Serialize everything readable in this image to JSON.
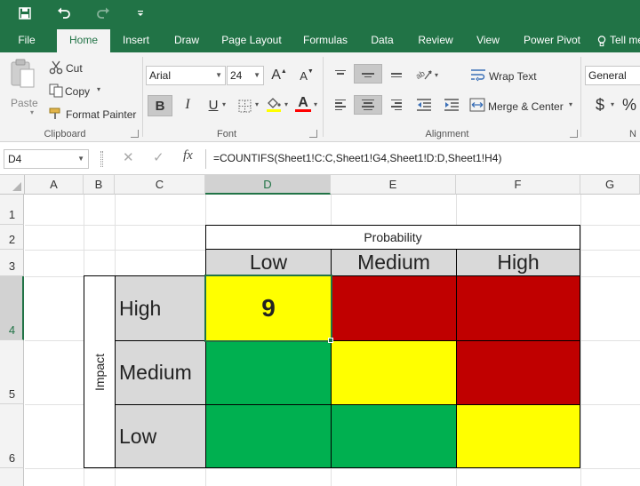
{
  "quick_access": {
    "icons": [
      "save-icon",
      "undo-icon",
      "redo-icon",
      "customize-qat-icon"
    ]
  },
  "tabs": [
    {
      "label": "File"
    },
    {
      "label": "Home",
      "active": true
    },
    {
      "label": "Insert"
    },
    {
      "label": "Draw"
    },
    {
      "label": "Page Layout"
    },
    {
      "label": "Formulas"
    },
    {
      "label": "Data"
    },
    {
      "label": "Review"
    },
    {
      "label": "View"
    },
    {
      "label": "Power Pivot"
    },
    {
      "label": "Tell me"
    }
  ],
  "ribbon": {
    "clipboard": {
      "paste": "Paste",
      "cut": "Cut",
      "copy": "Copy",
      "format_painter": "Format Painter",
      "group_label": "Clipboard"
    },
    "font": {
      "font_name": "Arial",
      "font_size": "24",
      "bold": "B",
      "italic": "I",
      "underline": "U",
      "grow_font": "A",
      "shrink_font": "A",
      "font_color": "A",
      "group_label": "Font"
    },
    "alignment": {
      "wrap_text": "Wrap Text",
      "merge_center": "Merge & Center",
      "group_label": "Alignment"
    },
    "number": {
      "format": "General",
      "currency": "$",
      "percent": "%",
      "group_label": "N"
    }
  },
  "formula_bar": {
    "name_box": "D4",
    "cancel": "✕",
    "enter": "✓",
    "fx": "fx",
    "formula": "=COUNTIFS(Sheet1!C:C,Sheet1!G4,Sheet1!D:D,Sheet1!H4)"
  },
  "grid": {
    "columns": [
      "A",
      "B",
      "C",
      "D",
      "E",
      "F",
      "G"
    ],
    "rows": [
      "1",
      "2",
      "3",
      "4",
      "5",
      "6"
    ],
    "selected_cell": "D4"
  },
  "matrix": {
    "probability_title": "Probability",
    "impact_title": "Impact",
    "probability_levels": [
      "Low",
      "Medium",
      "High"
    ],
    "impact_levels": [
      "High",
      "Medium",
      "Low"
    ],
    "d4_value": "9",
    "colors": {
      "red": "#c00000",
      "yellow": "#ffff00",
      "green": "#00b050",
      "header_gray": "#d9d9d9",
      "excel_green": "#217346"
    }
  }
}
